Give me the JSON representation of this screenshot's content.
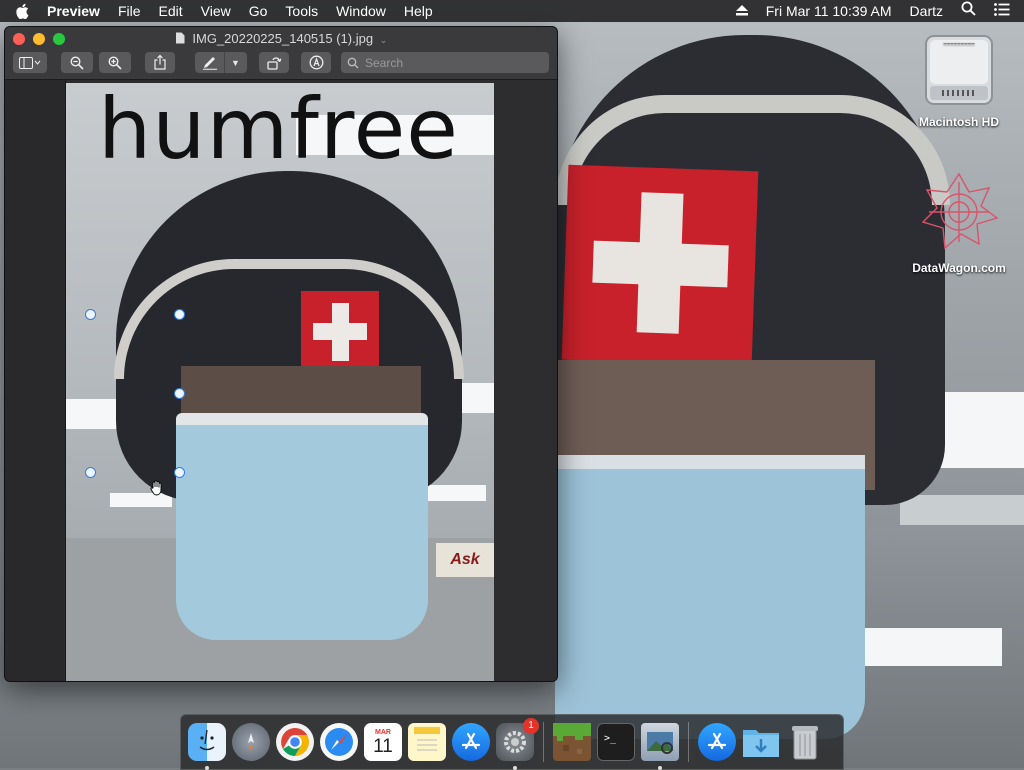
{
  "menubar": {
    "app_name": "Preview",
    "menus": [
      "File",
      "Edit",
      "View",
      "Go",
      "Tools",
      "Window",
      "Help"
    ],
    "clock": "Fri Mar 11  10:39 AM",
    "user": "Dartz"
  },
  "desktop_icons": [
    {
      "label": "Macintosh HD",
      "icon": "hard-drive-icon"
    },
    {
      "label": "DataWagon.com",
      "icon": "datawagon-icon"
    }
  ],
  "window": {
    "title": "IMG_20220225_140515 (1).jpg",
    "search_placeholder": "Search",
    "image_text": "humfree",
    "poster_text": "Ask"
  },
  "dock": {
    "calendar_month": "MAR",
    "calendar_day": "11",
    "badge_count": "1",
    "items": [
      "Finder",
      "Launchpad",
      "Google Chrome",
      "Safari",
      "Calendar",
      "Notes",
      "App Store",
      "System Preferences",
      "Minecraft",
      "Terminal",
      "Preview",
      "App Store",
      "Downloads",
      "Trash"
    ]
  },
  "colors": {
    "close": "#ff5f57",
    "minimize": "#febc2e",
    "zoom": "#28c840",
    "accent": "#2d7df0",
    "badge": "#e6332a"
  }
}
